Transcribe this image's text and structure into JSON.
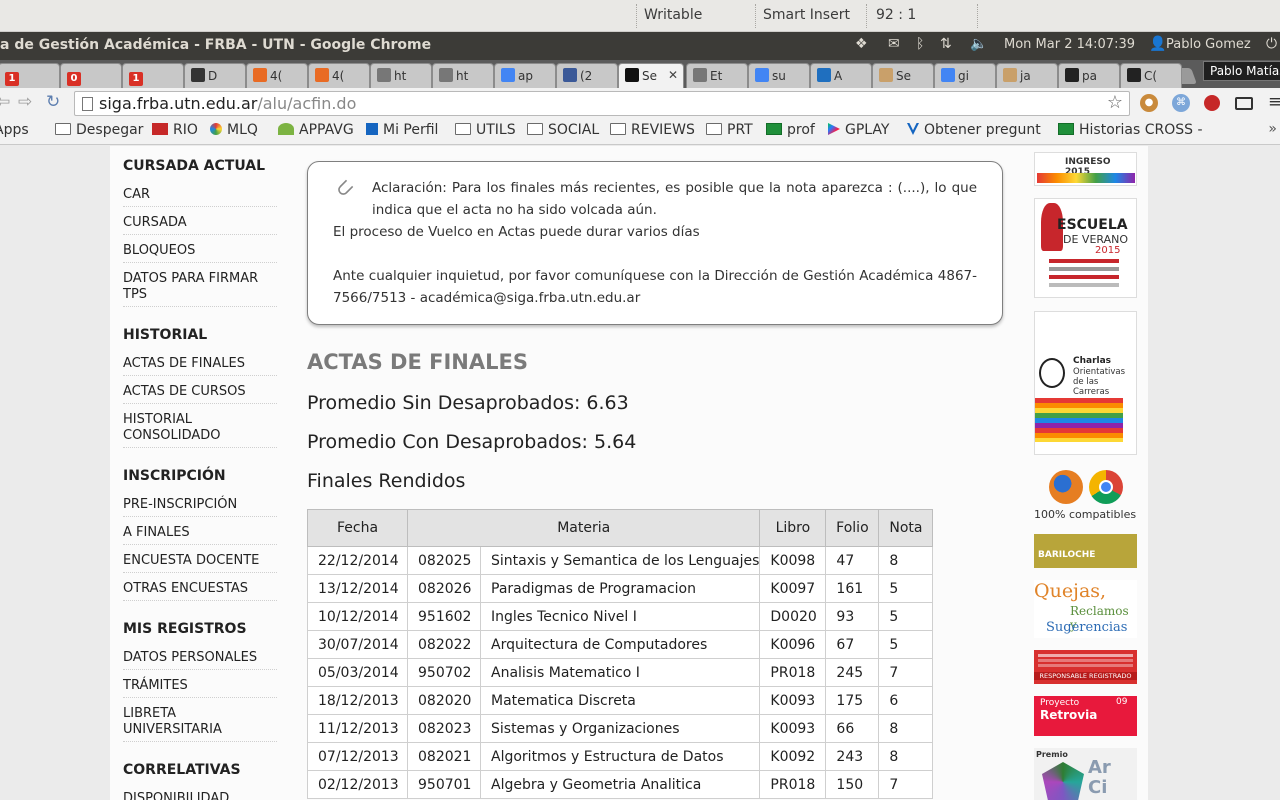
{
  "statusbar": {
    "mode": "Writable",
    "insert": "Smart Insert",
    "position": "92 : 1"
  },
  "panel": {
    "window_title": "a de Gestión Académica - FRBA - UTN - Google Chrome",
    "clock": "Mon Mar  2 14:07:39",
    "user": "Pablo Gomez"
  },
  "tabs": [
    {
      "label": "",
      "badge": "1",
      "icon": "gmail-icon",
      "color": "#d93025"
    },
    {
      "label": "",
      "badge": "0",
      "icon": "gmail-icon",
      "color": "#d93025"
    },
    {
      "label": "",
      "badge": "1",
      "icon": "gmail-icon",
      "color": "#d93025"
    },
    {
      "label": "D",
      "icon": "ux-icon",
      "color": "#333333"
    },
    {
      "label": "4(",
      "icon": "html5-icon",
      "color": "#e96b24"
    },
    {
      "label": "4(",
      "icon": "html5-icon",
      "color": "#e96b24"
    },
    {
      "label": "ht",
      "icon": "page-icon",
      "color": "#777777"
    },
    {
      "label": "ht",
      "icon": "page-icon",
      "color": "#777777"
    },
    {
      "label": "ap",
      "icon": "google-icon",
      "color": "#4285f4"
    },
    {
      "label": "(2",
      "icon": "facebook-icon",
      "color": "#3b5998"
    },
    {
      "label": "Se",
      "icon": "terminal-icon",
      "color": "#111111",
      "active": true
    },
    {
      "label": "Et",
      "icon": "puzzle-icon",
      "color": "#777777"
    },
    {
      "label": "su",
      "icon": "google-icon",
      "color": "#4285f4"
    },
    {
      "label": "A",
      "icon": "chat-icon",
      "color": "#1f6fbf"
    },
    {
      "label": "Se",
      "icon": "page-icon",
      "color": "#c9a06a"
    },
    {
      "label": "gi",
      "icon": "google-icon",
      "color": "#4285f4"
    },
    {
      "label": "ja",
      "icon": "page-icon",
      "color": "#c9a06a"
    },
    {
      "label": "pa",
      "icon": "github-icon",
      "color": "#222222"
    },
    {
      "label": "C(",
      "icon": "github-icon",
      "color": "#222222"
    }
  ],
  "tooltip": "Pablo Matías",
  "omnibox": {
    "host": "siga.frba.utn.edu.ar",
    "path": "/alu/acfin.do"
  },
  "bookmarks": [
    {
      "label": "Apps",
      "icon": "apps-icon"
    },
    {
      "label": "Despegar",
      "icon": "folder-icon"
    },
    {
      "label": "RIO",
      "icon": "rio-icon"
    },
    {
      "label": "MLQ",
      "icon": "mlq-icon"
    },
    {
      "label": "APPAVG",
      "icon": "appavg-icon"
    },
    {
      "label": "Mi Perfil",
      "icon": "dx-icon"
    },
    {
      "label": "UTILS",
      "icon": "folder-icon"
    },
    {
      "label": "SOCIAL",
      "icon": "folder-icon"
    },
    {
      "label": "REVIEWS",
      "icon": "folder-icon"
    },
    {
      "label": "PRT",
      "icon": "folder-icon"
    },
    {
      "label": "prof",
      "icon": "sheet-icon"
    },
    {
      "label": "GPLAY",
      "icon": "play-icon"
    },
    {
      "label": "Obtener pregunt",
      "icon": "check-icon"
    },
    {
      "label": "Historias CROSS -",
      "icon": "sheet-icon"
    }
  ],
  "sidebar": [
    {
      "heading": "CURSADA ACTUAL",
      "items": [
        "CAR",
        "CURSADA",
        "BLOQUEOS",
        "DATOS PARA FIRMAR TPS"
      ]
    },
    {
      "heading": "HISTORIAL",
      "items": [
        "ACTAS DE FINALES",
        "ACTAS DE CURSOS",
        "HISTORIAL CONSOLIDADO"
      ]
    },
    {
      "heading": "INSCRIPCIÓN",
      "items": [
        "PRE-INSCRIPCIÓN",
        "A FINALES",
        "ENCUESTA DOCENTE",
        "OTRAS ENCUESTAS"
      ]
    },
    {
      "heading": "MIS REGISTROS",
      "items": [
        "DATOS PERSONALES",
        "TRÁMITES",
        "LIBRETA UNIVERSITARIA"
      ]
    },
    {
      "heading": "CORRELATIVAS",
      "items": [
        "DISPONIBILIDAD"
      ]
    }
  ],
  "notice": {
    "line1": "Aclaración: Para los finales más recientes, es posible que la nota aparezca : (....), lo que indica que el acta no ha sido volcada aún.",
    "line2": "El proceso de Vuelco en Actas puede durar varios días",
    "line3": "Ante cualquier inquietud, por favor comuníquese con la Dirección de Gestión Académica 4867-7566/7513 - académica@siga.frba.utn.edu.ar"
  },
  "main": {
    "title": "ACTAS DE FINALES",
    "promedio_sin": "Promedio Sin Desaprobados: 6.63",
    "promedio_con": "Promedio Con Desaprobados: 5.64",
    "subtitle": "Finales Rendidos"
  },
  "table": {
    "headers": [
      "Fecha",
      "Materia",
      "Libro",
      "Folio",
      "Nota"
    ],
    "rows": [
      [
        "22/12/2014",
        "082025",
        "Sintaxis y Semantica de los Lenguajes",
        "K0098",
        "47",
        "8"
      ],
      [
        "13/12/2014",
        "082026",
        "Paradigmas de Programacion",
        "K0097",
        "161",
        "5"
      ],
      [
        "10/12/2014",
        "951602",
        "Ingles Tecnico Nivel I",
        "D0020",
        "93",
        "5"
      ],
      [
        "30/07/2014",
        "082022",
        "Arquitectura de Computadores",
        "K0096",
        "67",
        "5"
      ],
      [
        "05/03/2014",
        "950702",
        "Analisis Matematico I",
        "PR018",
        "245",
        "7"
      ],
      [
        "18/12/2013",
        "082020",
        "Matematica Discreta",
        "K0093",
        "175",
        "6"
      ],
      [
        "11/12/2013",
        "082023",
        "Sistemas y Organizaciones",
        "K0093",
        "66",
        "8"
      ],
      [
        "07/12/2013",
        "082021",
        "Algoritmos y Estructura de Datos",
        "K0092",
        "243",
        "8"
      ],
      [
        "02/12/2013",
        "950701",
        "Algebra y Geometria Analitica",
        "PR018",
        "150",
        "7"
      ]
    ]
  },
  "banners": {
    "ingreso": "INGRESO 2015",
    "escuela_1": "ESCUELA",
    "escuela_2": "DE VERANO",
    "escuela_3": "2015",
    "charlas_1": "Charlas",
    "charlas_2": "Orientativas",
    "charlas_3": "de las Carreras",
    "compatibles": "100% compatibles",
    "bariloche": "BARILOCHE",
    "quejas_1": "Quejas,",
    "quejas_2": "Reclamos y",
    "quejas_3": "Sugerencias",
    "registro": "RESPONSABLE REGISTRADO",
    "proyecto_1": "Proyecto",
    "proyecto_2": "Retrovia",
    "proyecto_num": "09",
    "premio": "Premio",
    "arci": "Ar Ci"
  },
  "colors": {
    "accent_red": "#c7262c",
    "link_blue": "#1a73c9"
  }
}
